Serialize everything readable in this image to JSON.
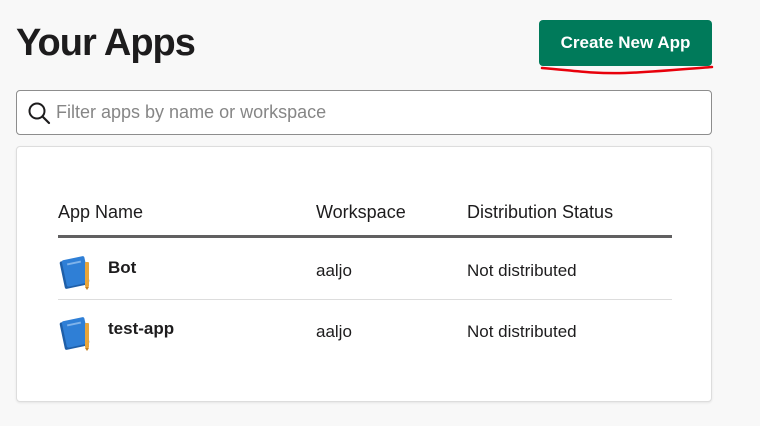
{
  "header": {
    "title": "Your Apps",
    "create_button_label": "Create New App"
  },
  "search": {
    "placeholder": "Filter apps by name or workspace",
    "value": ""
  },
  "table": {
    "columns": [
      "App Name",
      "Workspace",
      "Distribution Status"
    ],
    "rows": [
      {
        "name": "Bot",
        "workspace": "aaljo",
        "status": "Not distributed",
        "icon": "notebook-icon"
      },
      {
        "name": "test-app",
        "workspace": "aaljo",
        "status": "Not distributed",
        "icon": "notebook-icon"
      }
    ]
  },
  "colors": {
    "primary_button": "#007a5a",
    "annotation_underline": "#e8000b",
    "icon_blue": "#2f7fd6",
    "icon_pencil": "#e9a53a"
  }
}
